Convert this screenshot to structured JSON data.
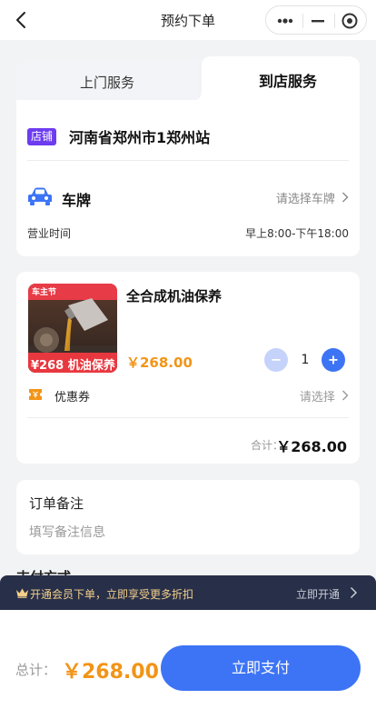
{
  "header": {
    "title": "预约下单"
  },
  "tabs": [
    {
      "label": "上门服务",
      "active": false
    },
    {
      "label": "到店服务",
      "active": true
    }
  ],
  "shop": {
    "tag": "店铺",
    "name": "河南省郑州市1郑州站",
    "plate_label": "车牌",
    "plate_select": "请选择车牌",
    "hours_label": "营业时间",
    "hours_value": "早上8:00-下午18:00"
  },
  "product": {
    "name": "全合成机油保养",
    "price": "￥268.00",
    "quantity": "1",
    "thumb_banner": "¥268 机油保养",
    "thumb_badge": "车主节",
    "coupon_label": "优惠券",
    "coupon_select": "请选择",
    "total_label": "合计：",
    "total_value": "￥268.00"
  },
  "note": {
    "title": "订单备注",
    "placeholder": "填写备注信息"
  },
  "peek_text": "支付方式",
  "member": {
    "text": "开通会员下单，立即享受更多折扣",
    "action": "立即开通"
  },
  "footer": {
    "total_label": "总计：",
    "total_value": "￥268.00",
    "pay_label": "立即支付"
  },
  "colors": {
    "accent": "#3d74f5",
    "price": "#f29417",
    "shop_tag": "#6d3cf0",
    "member_bar": "#283049",
    "member_text": "#f3cf8b"
  }
}
